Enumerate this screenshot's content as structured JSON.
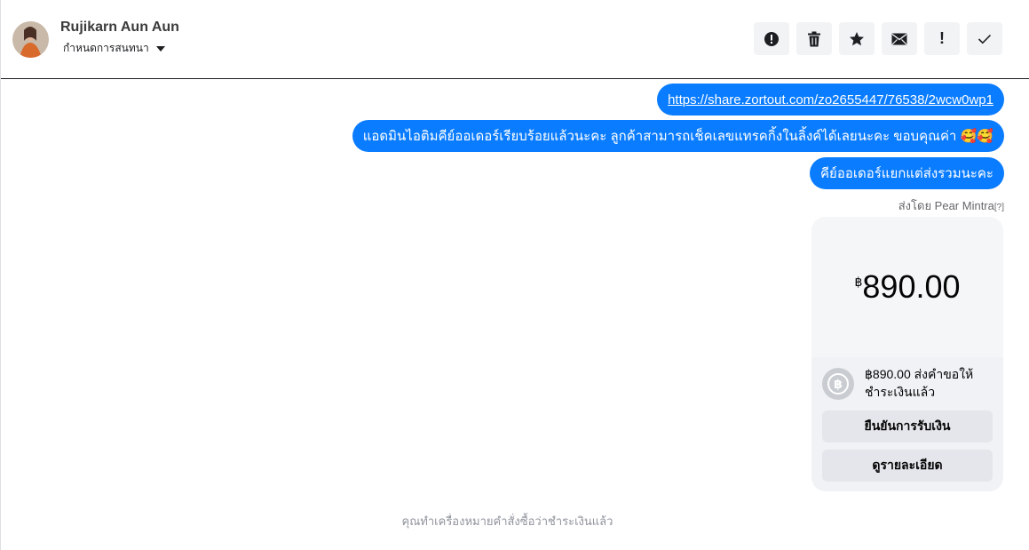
{
  "header": {
    "contact_name": "Rujikarn Aun Aun",
    "subtitle": "กำหนดการสนทนา",
    "toolbar": [
      {
        "icon": "alert-circle-icon",
        "text": ""
      },
      {
        "icon": "trash-icon",
        "text": ""
      },
      {
        "icon": "star-icon",
        "text": ""
      },
      {
        "icon": "envelope-icon",
        "text": ""
      },
      {
        "icon": "exclamation-icon",
        "text": "!"
      },
      {
        "icon": "checkmark-icon",
        "text": ""
      }
    ]
  },
  "messages": {
    "link": "https://share.zortout.com/zo2655447/76538/2wcw0wp1",
    "msg2": "แอดมินไอติมคีย์ออเดอร์เรียบร้อยแล้วนะคะ ลูกค้าสามารถเช็คเลขแทรคกิ้งในลิ้งค์ได้เลยนะคะ ขอบคุณค่า 🥰🥰",
    "msg3": "คีย์ออเดอร์แยกแต่ส่งรวมนะคะ",
    "sent_by": "ส่งโดย Pear Mintra",
    "sent_by_help": "[?]"
  },
  "payment": {
    "currency": "฿",
    "amount": "890.00",
    "info": "฿890.00 ส่งคำขอให้ชำระเงินแล้ว",
    "confirm_label": "ยืนยันการรับเงิน",
    "details_label": "ดูรายละเอียด"
  },
  "system_message": "คุณทำเครื่องหมายคำสั่งซื้อว่าชำระเงินแล้ว",
  "colors": {
    "bubble": "#0a7cff",
    "card": "#f0f2f5",
    "button": "#e4e6eb"
  }
}
